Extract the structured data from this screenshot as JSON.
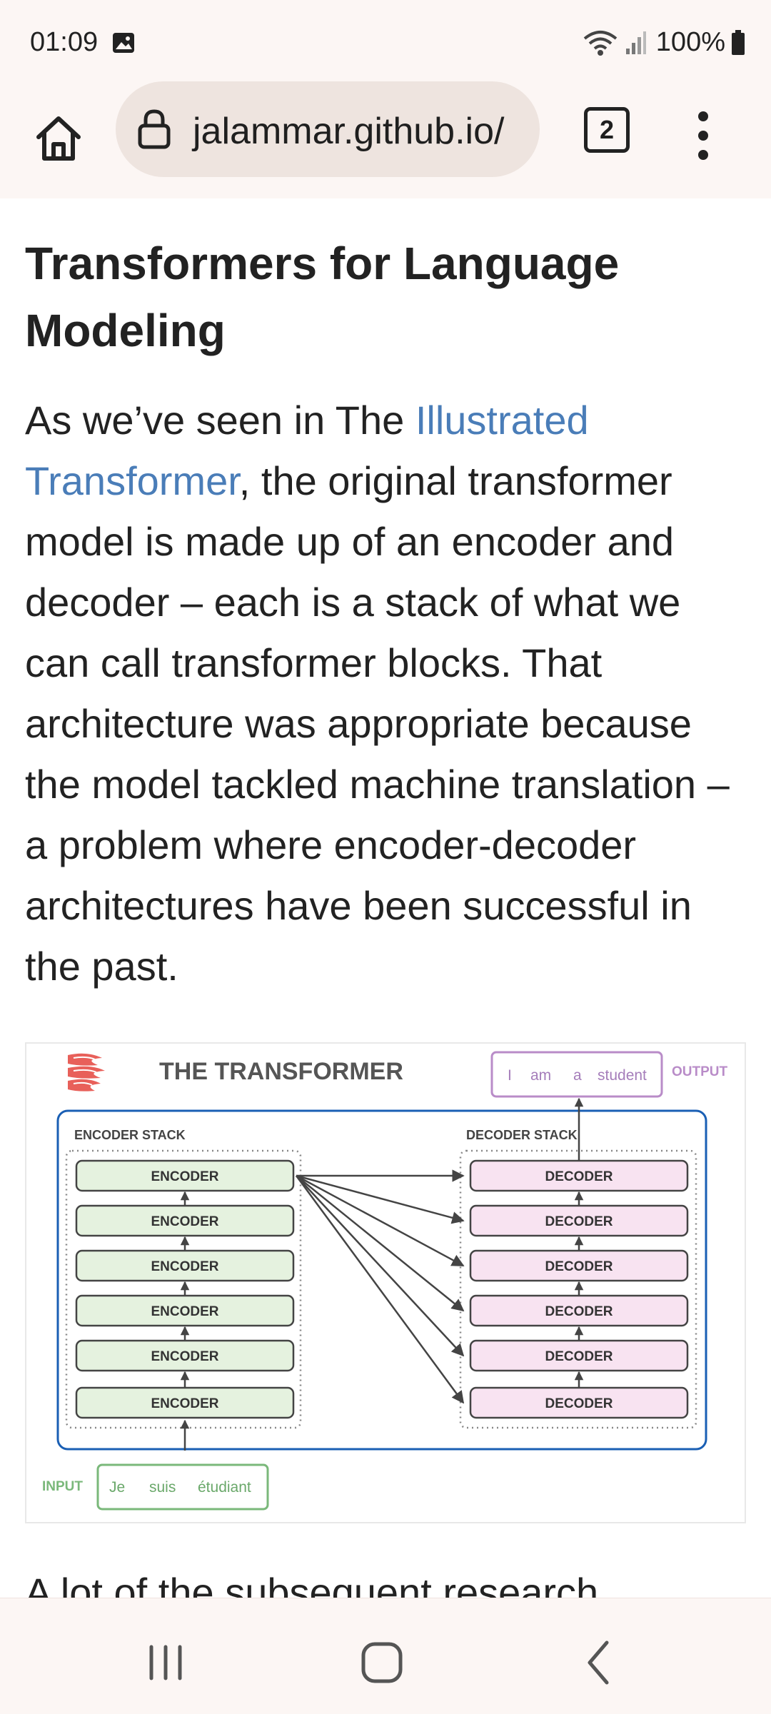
{
  "status_bar": {
    "time": "01:09",
    "battery": "100%"
  },
  "browser": {
    "url": "jalammar.github.io/",
    "tab_count": "2"
  },
  "article": {
    "heading": "Transformers for Language Modeling",
    "para_intro": "As we’ve seen in The ",
    "para_link": "Illustrated Transformer",
    "para_rest": ", the original transformer model is made up of an encoder and decoder – each is a stack of what we can call transformer blocks. That architecture was appropriate because the model tackled machine translation – a problem where encoder-decoder architectures have been successful in the past.",
    "next_para_partial": "A lot of the subsequent research"
  },
  "figure": {
    "title": "THE TRANSFORMER",
    "encoder_stack_label": "ENCODER STACK",
    "decoder_stack_label": "DECODER STACK",
    "encoder_label": "ENCODER",
    "decoder_label": "DECODER",
    "input_label": "INPUT",
    "output_label": "OUTPUT",
    "input_tokens": [
      "Je",
      "suis",
      "étudiant"
    ],
    "output_tokens": [
      "I",
      "am",
      "a",
      "student"
    ],
    "colors": {
      "encoder_fill": "#e5f2df",
      "decoder_fill": "#f8e3f1",
      "stack_border": "#1a5fb4",
      "input_green": "#7ab87a",
      "output_purple": "#b98cc8",
      "flame": "#e8605a"
    }
  }
}
